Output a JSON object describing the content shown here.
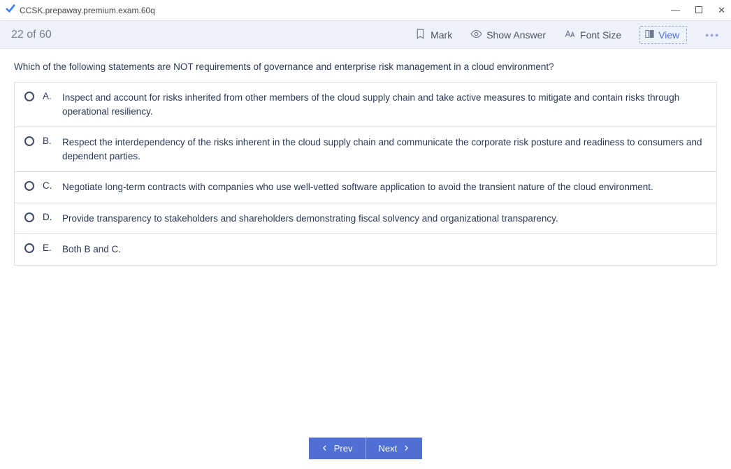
{
  "titlebar": {
    "title": "CCSK.prepaway.premium.exam.60q"
  },
  "toolbar": {
    "counter": "22 of 60",
    "mark_label": "Mark",
    "show_answer_label": "Show Answer",
    "font_size_label": "Font Size",
    "view_label": "View"
  },
  "question": {
    "text": "Which of the following statements are NOT requirements of governance and enterprise risk management in a cloud environment?",
    "options": [
      {
        "letter": "A.",
        "text": "Inspect and account for risks inherited from other members of the cloud supply chain and take active measures to mitigate and contain risks through operational resiliency."
      },
      {
        "letter": "B.",
        "text": "Respect the interdependency of the risks inherent in the cloud supply chain and communicate the corporate risk posture and readiness to consumers and dependent parties."
      },
      {
        "letter": "C.",
        "text": "Negotiate long-term contracts with companies who use well-vetted software application to avoid the transient nature of the cloud environment."
      },
      {
        "letter": "D.",
        "text": "Provide transparency to stakeholders and shareholders demonstrating fiscal solvency and organizational transparency."
      },
      {
        "letter": "E.",
        "text": "Both B and C."
      }
    ]
  },
  "footer": {
    "prev_label": "Prev",
    "next_label": "Next"
  }
}
